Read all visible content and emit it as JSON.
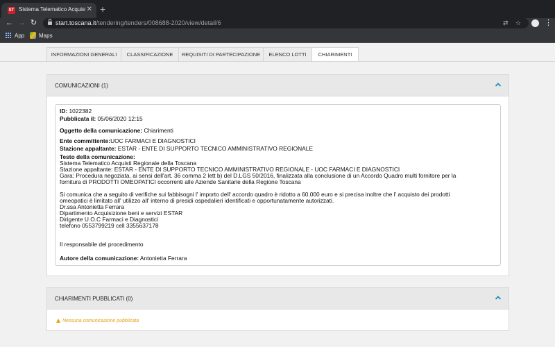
{
  "browser": {
    "tab_title": "Sistema Telematico Acquisti Re",
    "tab_favicon_text": "ST",
    "url_host": "start.toscana.it",
    "url_path": "/tendering/tenders/008688-2020/view/detail/6",
    "bookmarks": [
      {
        "label": "App",
        "icon": "apps-grid-icon"
      },
      {
        "label": "Maps",
        "icon": "maps-icon"
      }
    ]
  },
  "tabs": [
    {
      "label": "INFORMAZIONI GENERALI",
      "active": false
    },
    {
      "label": "CLASSIFICAZIONE",
      "active": false
    },
    {
      "label": "REQUISITI DI PARTECIPAZIONE",
      "active": false
    },
    {
      "label": "ELENCO LOTTI",
      "active": false
    },
    {
      "label": "CHIARIMENTI",
      "active": true
    }
  ],
  "comunicazioni": {
    "title": "COMUNICAZIONI (1)",
    "id_label": "ID:",
    "id_value": "1022382",
    "published_label": "Pubblicata il:",
    "published_value": "05/06/2020 12:15",
    "subject_label": "Oggetto della comunicazione:",
    "subject_value": "Chiarimenti",
    "client_label": "Ente committente:",
    "client_value": "UOC FARMACI E DIAGNOSTICI",
    "contracting_label": "Stazione appaltante:",
    "contracting_value": "ESTAR - ENTE DI SUPPORTO TECNICO AMMINISTRATIVO REGIONALE",
    "text_label": "Testo della comunicazione:",
    "text_lines": [
      "Sistema Telematico Acquisti Regionale della Toscana",
      "Stazione appaltante: ESTAR - ENTE DI SUPPORTO TECNICO AMMINISTRATIVO REGIONALE - UOC FARMACI E DIAGNOSTICI",
      "Gara: Procedura negoziata, ai sensi dell'art. 36 comma 2 lett b) del D.LGS 50/2016, finalizzata alla conclusione di un Accordo Quadro multi fornitore per la",
      "fornitura di PRODOTTI OMEOPATICI occorrenti alle Aziende Sanitarie della Regione Toscana"
    ],
    "body_lines": [
      "Si comunica che a seguito di verifiche sui fabbisogni l' importo dell' accordo quadro è ridotto a 60.000 euro e si precisa inoltre che l' acquisto dei prodotti",
      "omeopatici è limitato all' utilizzo all' interno di presidi ospedalieri identificati e opportunatamente autorizzati.",
      "Dr.ssa Antonietta Ferrara",
      "Dipartimento Acquisizione beni e servizi ESTAR",
      "Dirigente U.O.C Farmaci e Diagnostici",
      "telefono 0553799219 cell 3355637178"
    ],
    "responsible": "Il responsabile del procedimento",
    "author_label": "Autore della comunicazione:",
    "author_value": "Antonietta Ferrara"
  },
  "chiarimenti": {
    "title": "CHIARIMENTI PUBBLICATI (0)",
    "empty_message": "Nessuna comunicazione pubblicata"
  },
  "colors": {
    "accent": "#1a8fb7",
    "warning": "#e5a00d"
  }
}
